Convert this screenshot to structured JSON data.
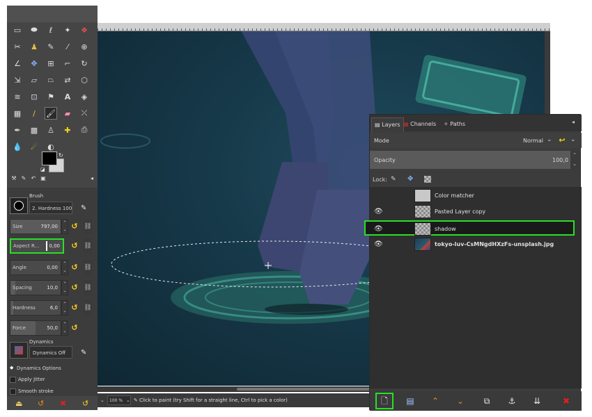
{
  "toolbox": {
    "tool_options": {
      "brush_label": "Brush",
      "brush_name": "2. Hardness 100",
      "size_label": "Size",
      "size_value": "797,00",
      "aspect_label": "Aspect R...",
      "aspect_value": "0,00",
      "angle_label": "Angle",
      "angle_value": "0,00",
      "spacing_label": "Spacing",
      "spacing_value": "10,0",
      "hardness_label": "Hardness",
      "hardness_value": "6,0",
      "force_label": "Force",
      "force_value": "50,0",
      "dynamics_label": "Dynamics",
      "dynamics_value": "Dynamics Off",
      "dynamics_options_label": "Dynamics Options",
      "apply_jitter_label": "Apply Jitter",
      "smooth_stroke_label": "Smooth stroke"
    }
  },
  "statusbar": {
    "zoom": "100 %",
    "message": "Click to paint (try Shift for a straight line, Ctrl to pick a color)"
  },
  "layers_dock": {
    "tabs": [
      "Layers",
      "Channels",
      "Paths"
    ],
    "mode_label": "Mode",
    "mode_value": "Normal",
    "opacity_label": "Opacity",
    "opacity_value": "100,0",
    "lock_label": "Lock:",
    "layers": [
      {
        "name": "Color matcher",
        "visible": false,
        "selected": false,
        "thumb": "gray"
      },
      {
        "name": "Pasted Layer copy",
        "visible": true,
        "selected": false,
        "thumb": "checker"
      },
      {
        "name": "shadow",
        "visible": true,
        "selected": true,
        "thumb": "checker"
      },
      {
        "name": "tokyo-luv-CsMNgdHXzFs-unsplash.jpg",
        "visible": true,
        "selected": false,
        "thumb": "photo"
      }
    ]
  },
  "colors": {
    "highlight": "#28e028",
    "accent_yellow": "#ffd21a",
    "accent_orange": "#f08a1a",
    "accent_red": "#e02020",
    "canvas_teal": "#163848"
  },
  "icons": {
    "eye": "eye-icon",
    "new_layer": "new-layer-icon",
    "new_group": "new-layer-group-icon",
    "raise": "raise-layer-icon",
    "lower": "lower-layer-icon",
    "duplicate": "duplicate-layer-icon",
    "anchor": "anchor-layer-icon",
    "merge": "merge-down-icon",
    "delete": "delete-layer-icon"
  }
}
